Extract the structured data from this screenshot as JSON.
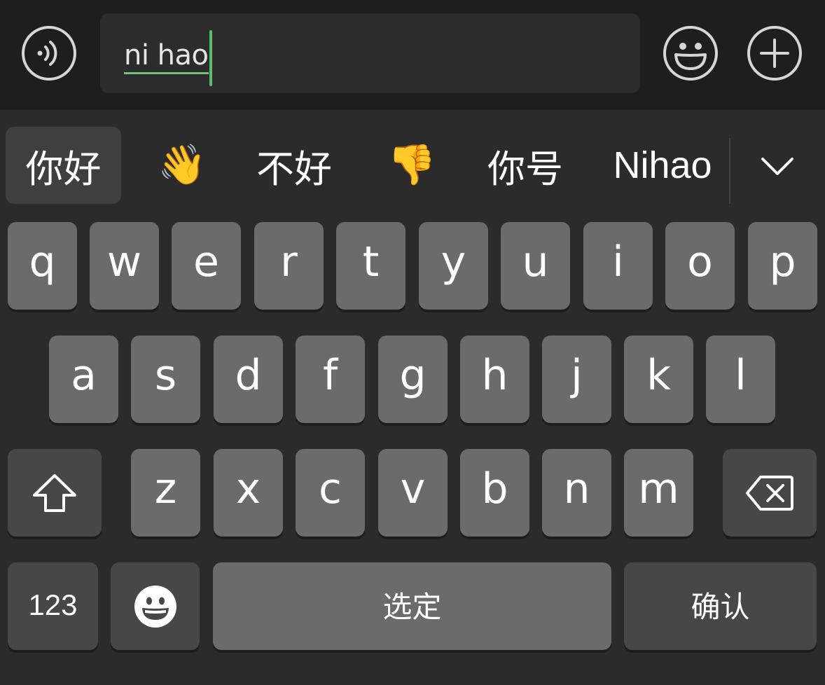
{
  "input_bar": {
    "voice_icon": "voice-wave-icon",
    "composition_text": "ni hao",
    "emoji_icon": "smiley-face-icon",
    "plus_icon": "plus-circle-icon",
    "accent_color": "#57be6a"
  },
  "candidates": {
    "items": [
      {
        "label": "你好",
        "kind": "text",
        "selected": true
      },
      {
        "label": "👋",
        "kind": "emoji",
        "selected": false
      },
      {
        "label": "不好",
        "kind": "text",
        "selected": false
      },
      {
        "label": "👎",
        "kind": "emoji",
        "selected": false
      },
      {
        "label": "你号",
        "kind": "text",
        "selected": false
      },
      {
        "label": "Nihao",
        "kind": "text",
        "selected": false
      }
    ],
    "expand_icon": "chevron-down-icon"
  },
  "keyboard": {
    "row1": [
      "q",
      "w",
      "e",
      "r",
      "t",
      "y",
      "u",
      "i",
      "o",
      "p"
    ],
    "row2": [
      "a",
      "s",
      "d",
      "f",
      "g",
      "h",
      "j",
      "k",
      "l"
    ],
    "row3": [
      "z",
      "x",
      "c",
      "v",
      "b",
      "n",
      "m"
    ],
    "shift_icon": "shift-arrow-icon",
    "delete_icon": "backspace-icon",
    "numbers_label": "123",
    "emoji_key_icon": "emoji-face-icon",
    "space_label": "选定",
    "confirm_label": "确认"
  },
  "colors": {
    "bar_background": "#1e1e1e",
    "keyboard_background": "#2b2b2b",
    "letter_key": "#6b6b6b",
    "function_key": "#474747"
  }
}
